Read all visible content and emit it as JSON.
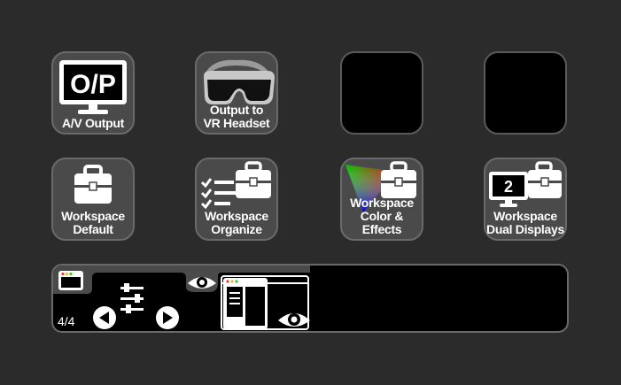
{
  "keys": {
    "av_output": {
      "label_line1": "A/V Output",
      "art_text": "O/P"
    },
    "vr_headset": {
      "label_line1": "Output to",
      "label_line2": "VR Headset"
    },
    "ws_default": {
      "label_line1": "Workspace",
      "label_line2": "Default"
    },
    "ws_organize": {
      "label_line1": "Workspace",
      "label_line2": "Organize"
    },
    "ws_color": {
      "label_line1": "Workspace",
      "label_line2": "Color & Effects"
    },
    "ws_dual": {
      "label_line1": "Workspace",
      "label_line2": "Dual Displays",
      "art_text": "2"
    }
  },
  "strip": {
    "page_counter": "4/4"
  },
  "colors": {
    "background": "#2b2b2b",
    "key_fill": "#4a4a4a",
    "key_border": "#6a6a6a",
    "dot_red": "#e04040",
    "dot_yellow": "#e0c040",
    "dot_green": "#40c040"
  },
  "icons": [
    "monitor-icon",
    "vr-headset-icon",
    "briefcase-icon",
    "checklist-icon",
    "color-triangle-icon",
    "dual-display-icon",
    "window-icon",
    "sliders-icon",
    "eye-icon",
    "arrow-left-icon",
    "arrow-right-icon"
  ]
}
